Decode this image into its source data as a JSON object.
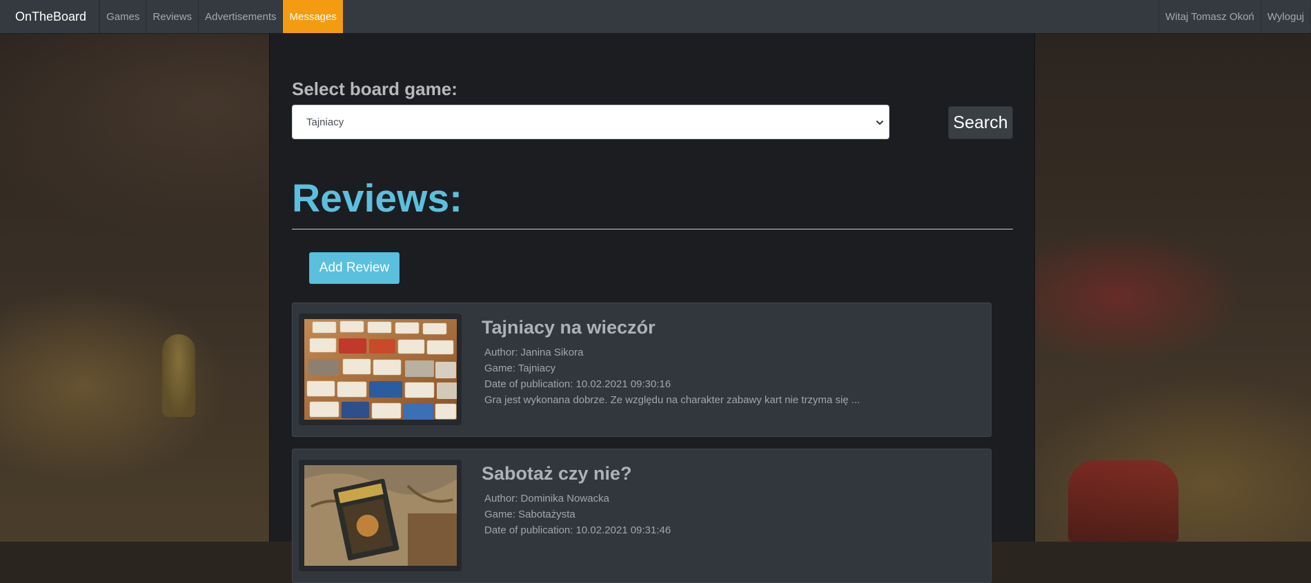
{
  "navbar": {
    "brand": "OnTheBoard",
    "items": [
      {
        "label": "Games"
      },
      {
        "label": "Reviews"
      },
      {
        "label": "Advertisements"
      },
      {
        "label": "Messages",
        "active": true
      }
    ],
    "right": {
      "greeting": "Witaj Tomasz Okoń",
      "logout": "Wyloguj"
    },
    "active_color": "#f39c12"
  },
  "search": {
    "label": "Select board game:",
    "selected_game": "Tajniacy",
    "button_label": "Search"
  },
  "reviews": {
    "heading": "Reviews:",
    "add_label": "Add Review",
    "accent_color": "#5bc0de",
    "items": [
      {
        "title": "Tajniacy na wieczór",
        "author": "Author: Janina Sikora",
        "game": "Game: Tajniacy",
        "date": "Date of publication: 10.02.2021 09:30:16",
        "excerpt": "Gra jest wykonana dobrze. Ze względu na charakter zabawy kart nie trzyma się ..."
      },
      {
        "title": "Sabotaż czy nie?",
        "author": "Author: Dominika Nowacka",
        "game": "Game: Sabotażysta",
        "date": "Date of publication: 10.02.2021 09:31:46",
        "excerpt": ""
      }
    ]
  }
}
